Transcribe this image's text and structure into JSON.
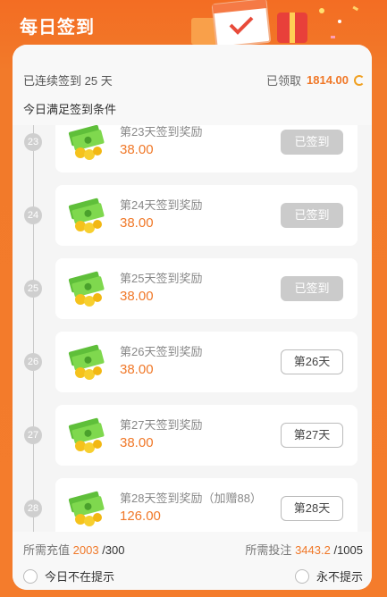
{
  "header": {
    "title": "每日签到"
  },
  "stats": {
    "streak_prefix": "已连续签到",
    "streak_days": "25",
    "streak_suffix": "天",
    "claimed_label": "已领取",
    "claimed_amount": "1814.00",
    "condition_text": "今日满足签到条件"
  },
  "rewards": [
    {
      "day": "23",
      "title": "第23天签到奖励",
      "value": "38.00",
      "button": "已签到",
      "status": "done"
    },
    {
      "day": "24",
      "title": "第24天签到奖励",
      "value": "38.00",
      "button": "已签到",
      "status": "done"
    },
    {
      "day": "25",
      "title": "第25天签到奖励",
      "value": "38.00",
      "button": "已签到",
      "status": "done"
    },
    {
      "day": "26",
      "title": "第26天签到奖励",
      "value": "38.00",
      "button": "第26天",
      "status": "todo"
    },
    {
      "day": "27",
      "title": "第27天签到奖励",
      "value": "38.00",
      "button": "第27天",
      "status": "todo"
    },
    {
      "day": "28",
      "title": "第28天签到奖励（加赠88）",
      "value": "126.00",
      "button": "第28天",
      "status": "todo"
    }
  ],
  "footer": {
    "recharge_label": "所需充值",
    "recharge_current": "2003",
    "recharge_target": "/300",
    "bet_label": "所需投注",
    "bet_current": "3443.2",
    "bet_target": "/1005",
    "no_remind_today": "今日不在提示",
    "never_remind": "永不提示"
  },
  "colors": {
    "accent": "#f07828",
    "done_button": "#cbcbcb",
    "dot": "#cfcfcf"
  }
}
